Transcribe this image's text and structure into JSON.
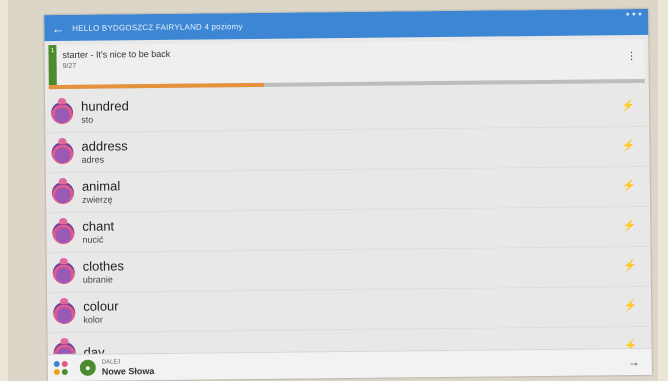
{
  "header": {
    "title": "HELLO BYDGOSZCZ FAIRYLAND 4 poziomy",
    "back_icon": "arrow-left-icon",
    "accent": "#3d86d4"
  },
  "lesson": {
    "number": "1",
    "title": "starter - It's nice to be back",
    "count": "9/27",
    "progress": 0.36,
    "progress_color": "#e6923c"
  },
  "words": [
    {
      "term": "hundred",
      "translation": "sto",
      "status_icon": "lightning-icon",
      "active": false
    },
    {
      "term": "address",
      "translation": "adres",
      "status_icon": "lightning-icon",
      "active": false
    },
    {
      "term": "animal",
      "translation": "zwierzę",
      "status_icon": "lightning-icon",
      "active": true
    },
    {
      "term": "chant",
      "translation": "nucić",
      "status_icon": "lightning-icon",
      "active": false
    },
    {
      "term": "clothes",
      "translation": "ubranie",
      "status_icon": "lightning-icon",
      "active": false
    },
    {
      "term": "colour",
      "translation": "kolor",
      "status_icon": "lightning-icon",
      "active": false
    },
    {
      "term": "day",
      "translation": "",
      "status_icon": "lightning-icon",
      "active": true
    }
  ],
  "footer": {
    "next_small": "DALEJ",
    "next_main": "Nowe Słowa",
    "grid_colors": [
      "#3d86d4",
      "#e05a8a",
      "#f0a020",
      "#4c8b2e"
    ]
  }
}
